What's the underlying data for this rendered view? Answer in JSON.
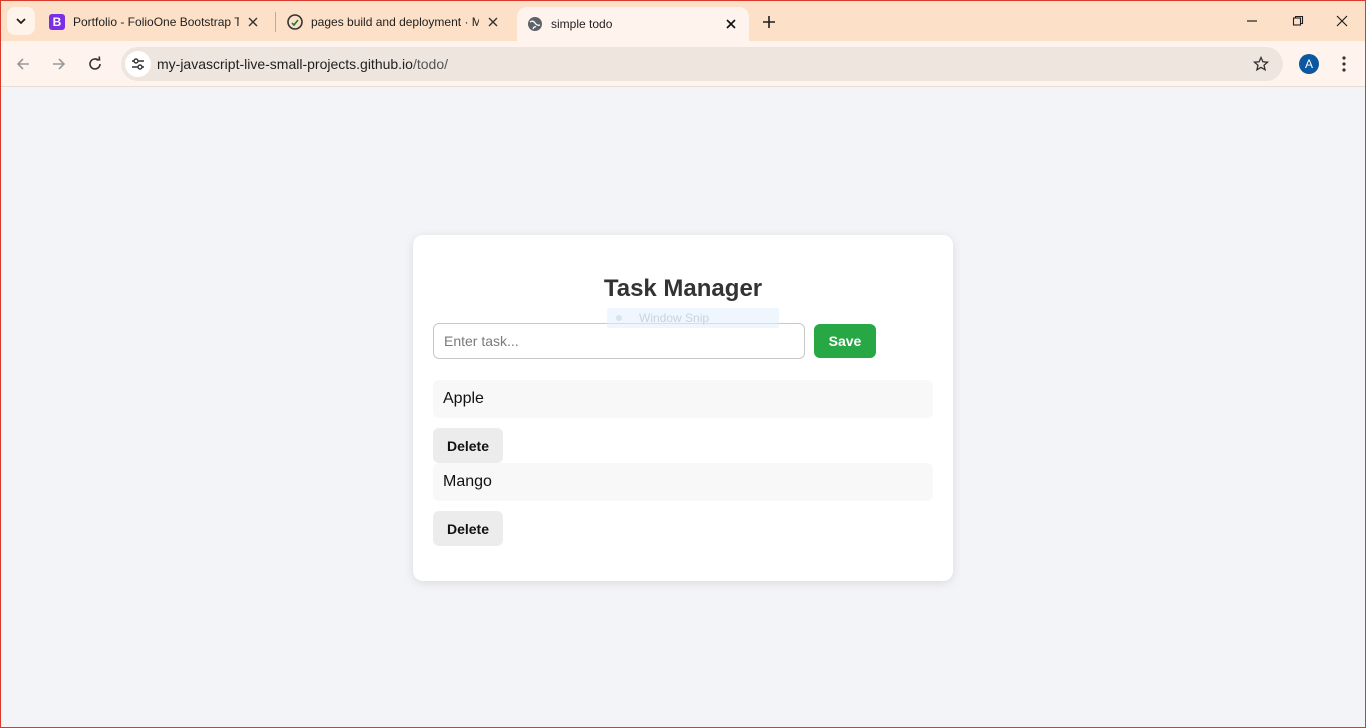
{
  "browser": {
    "tabs": [
      {
        "title": "Portfolio - FolioOne Bootstrap Template",
        "favicon": "bootstrap-icon",
        "active": false
      },
      {
        "title": "pages build and deployment · My-JavaScript",
        "favicon": "github-icon",
        "active": false
      },
      {
        "title": "simple todo",
        "favicon": "globe-icon",
        "active": true
      }
    ],
    "url_host": "my-javascript-live-small-projects.github.io",
    "url_path": "/todo/",
    "profile_initial": "A",
    "colors": {
      "tabstrip": "#fde0c8",
      "toolbar": "#fff3ee",
      "profile": "#0b57a0"
    }
  },
  "overlay": {
    "window_snip_label": "Window Snip"
  },
  "app": {
    "title": "Task Manager",
    "input": {
      "value": "",
      "placeholder": "Enter task..."
    },
    "save_label": "Save",
    "delete_label": "Delete",
    "tasks": [
      "Apple",
      "Mango"
    ],
    "colors": {
      "save": "#28a745",
      "delete": "#ececec",
      "item_bg": "#f8f8f8",
      "page_bg": "#f3f4f7"
    }
  }
}
